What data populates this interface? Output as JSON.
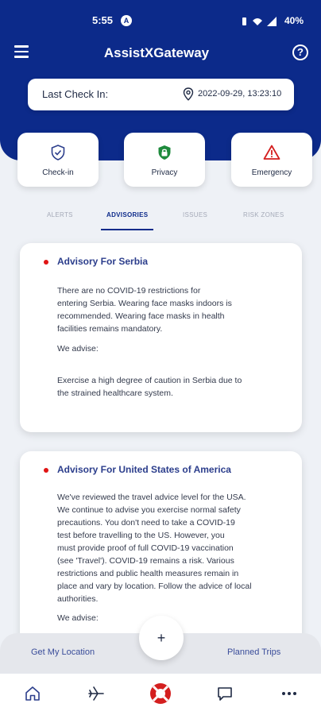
{
  "status_bar": {
    "time": "5:55",
    "notification_letter": "A",
    "battery": "40%"
  },
  "header": {
    "title": "AssistXGateway"
  },
  "check_in": {
    "label": "Last Check In:",
    "value": "2022-09-29, 13:23:10"
  },
  "actions": [
    {
      "label": "Check-in",
      "icon": "shield-check-icon"
    },
    {
      "label": "Privacy",
      "icon": "lock-icon"
    },
    {
      "label": "Emergency",
      "icon": "warning-icon"
    }
  ],
  "tabs": [
    {
      "label": "ALERTS",
      "active": false
    },
    {
      "label": "ADVISORIES",
      "active": true
    },
    {
      "label": "ISSUES",
      "active": false
    },
    {
      "label": "RISK ZONES",
      "active": false
    }
  ],
  "advisories": [
    {
      "title": "Advisory For Serbia",
      "body_lines": [
        "There are no COVID-19 restrictions for",
        "entering Serbia. Wearing face masks indoors is",
        "recommended. Wearing face masks in health",
        "facilities remains mandatory."
      ],
      "advise_label": "We advise:",
      "extra_lines": [
        "Exercise a high degree of caution in Serbia due to",
        "the strained healthcare system."
      ]
    },
    {
      "title": "Advisory For United States of America",
      "body_lines": [
        "We've reviewed the travel advice level for the USA.",
        "We continue to advise you exercise normal safety",
        "precautions. You don't need to take a COVID-19",
        "test before travelling to the US. However, you",
        "must provide proof of full COVID-19 vaccination",
        "(see 'Travel'). COVID-19 remains a risk. Various",
        "restrictions and public health measures remain in",
        "place and vary by location. Follow the advice of local",
        "authorities."
      ],
      "advise_label": "We advise:"
    }
  ],
  "bottom_actions": {
    "left": "Get My Location",
    "fab": "+",
    "right": "Planned Trips"
  },
  "nav": [
    {
      "icon": "home-icon"
    },
    {
      "icon": "airplane-icon"
    },
    {
      "icon": "lifebuoy-icon"
    },
    {
      "icon": "chat-icon"
    },
    {
      "icon": "more-icon"
    }
  ],
  "colors": {
    "primary": "#0c2a8a",
    "alert_dot": "#e01414",
    "emergency": "#d41f1f"
  }
}
